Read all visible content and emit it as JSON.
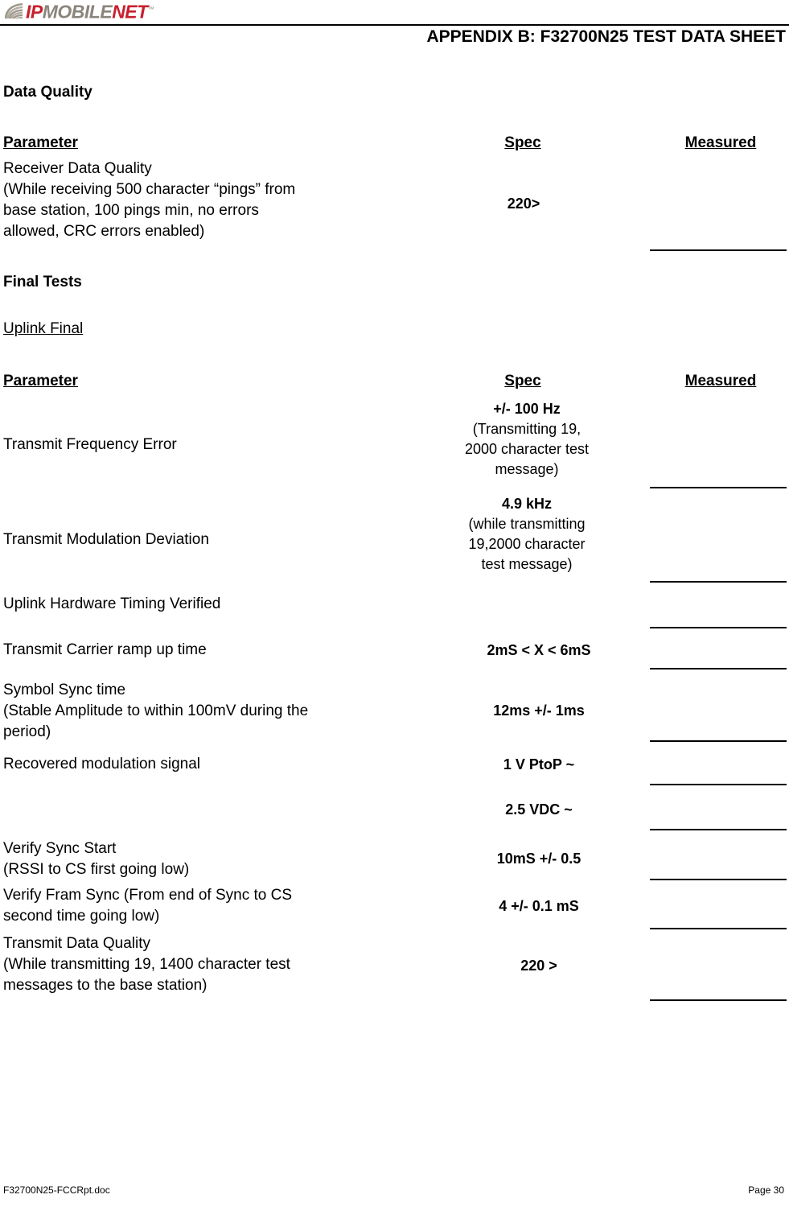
{
  "header": {
    "logo": {
      "part1": "IP",
      "part2": "MOBILE",
      "part3": "NET",
      "trademark": "™"
    },
    "title": "APPENDIX B:  F32700N25 TEST DATA SHEET"
  },
  "sections": [
    {
      "heading": "Data Quality",
      "columns": {
        "parameter": "Parameter",
        "spec": "Spec",
        "measured": "Measured"
      },
      "rows": [
        {
          "parameter": "Receiver   Data Quality\n(While receiving 500 character “pings” from\nbase station, 100 pings min, no errors\nallowed, CRC errors enabled)",
          "spec_bold": "220>",
          "spec_note": "",
          "measured": ""
        }
      ]
    },
    {
      "heading": "Final Tests",
      "subheading": "Uplink Final",
      "columns": {
        "parameter": "Parameter",
        "spec": "Spec",
        "measured": "Measured"
      },
      "rows": [
        {
          "parameter": "Transmit Frequency Error",
          "spec_bold": "+/- 100 Hz",
          "spec_note": "(Transmitting 19,\n2000 character test\nmessage)",
          "measured": ""
        },
        {
          "parameter": "Transmit Modulation Deviation",
          "spec_bold": "4.9 kHz",
          "spec_note": "(while transmitting\n19,2000 character\ntest message)",
          "measured": ""
        },
        {
          "parameter": "Uplink Hardware Timing Verified",
          "spec_bold": "",
          "spec_note": "",
          "measured": ""
        },
        {
          "parameter": "Transmit Carrier ramp up time",
          "spec_bold": "2mS < X < 6mS",
          "spec_note": "",
          "measured": ""
        },
        {
          "parameter": "Symbol Sync time\n(Stable Amplitude to within 100mV during the\nperiod)",
          "spec_bold": "12ms +/- 1ms",
          "spec_note": "",
          "measured": ""
        },
        {
          "parameter": "Recovered modulation signal",
          "spec_bold": "1 V PtoP ~",
          "spec_note": "",
          "measured": ""
        },
        {
          "parameter": "",
          "spec_bold": "2.5 VDC ~",
          "spec_note": "",
          "measured": ""
        },
        {
          "parameter": "Verify Sync Start\n(RSSI to CS first going low)",
          "spec_bold": "10mS +/- 0.5",
          "spec_note": "",
          "measured": ""
        },
        {
          "parameter": "Verify Fram Sync (From end of Sync to CS\nsecond time going low)",
          "spec_bold": "4 +/- 0.1 mS",
          "spec_note": "",
          "measured": ""
        },
        {
          "parameter": "Transmit Data Quality\n(While transmitting 19, 1400 character test\nmessages to the base station)",
          "spec_bold": "220 >",
          "spec_note": "",
          "measured": ""
        }
      ]
    }
  ],
  "footer": {
    "filename": "F32700N25-FCCRpt.doc",
    "page": "Page 30"
  }
}
